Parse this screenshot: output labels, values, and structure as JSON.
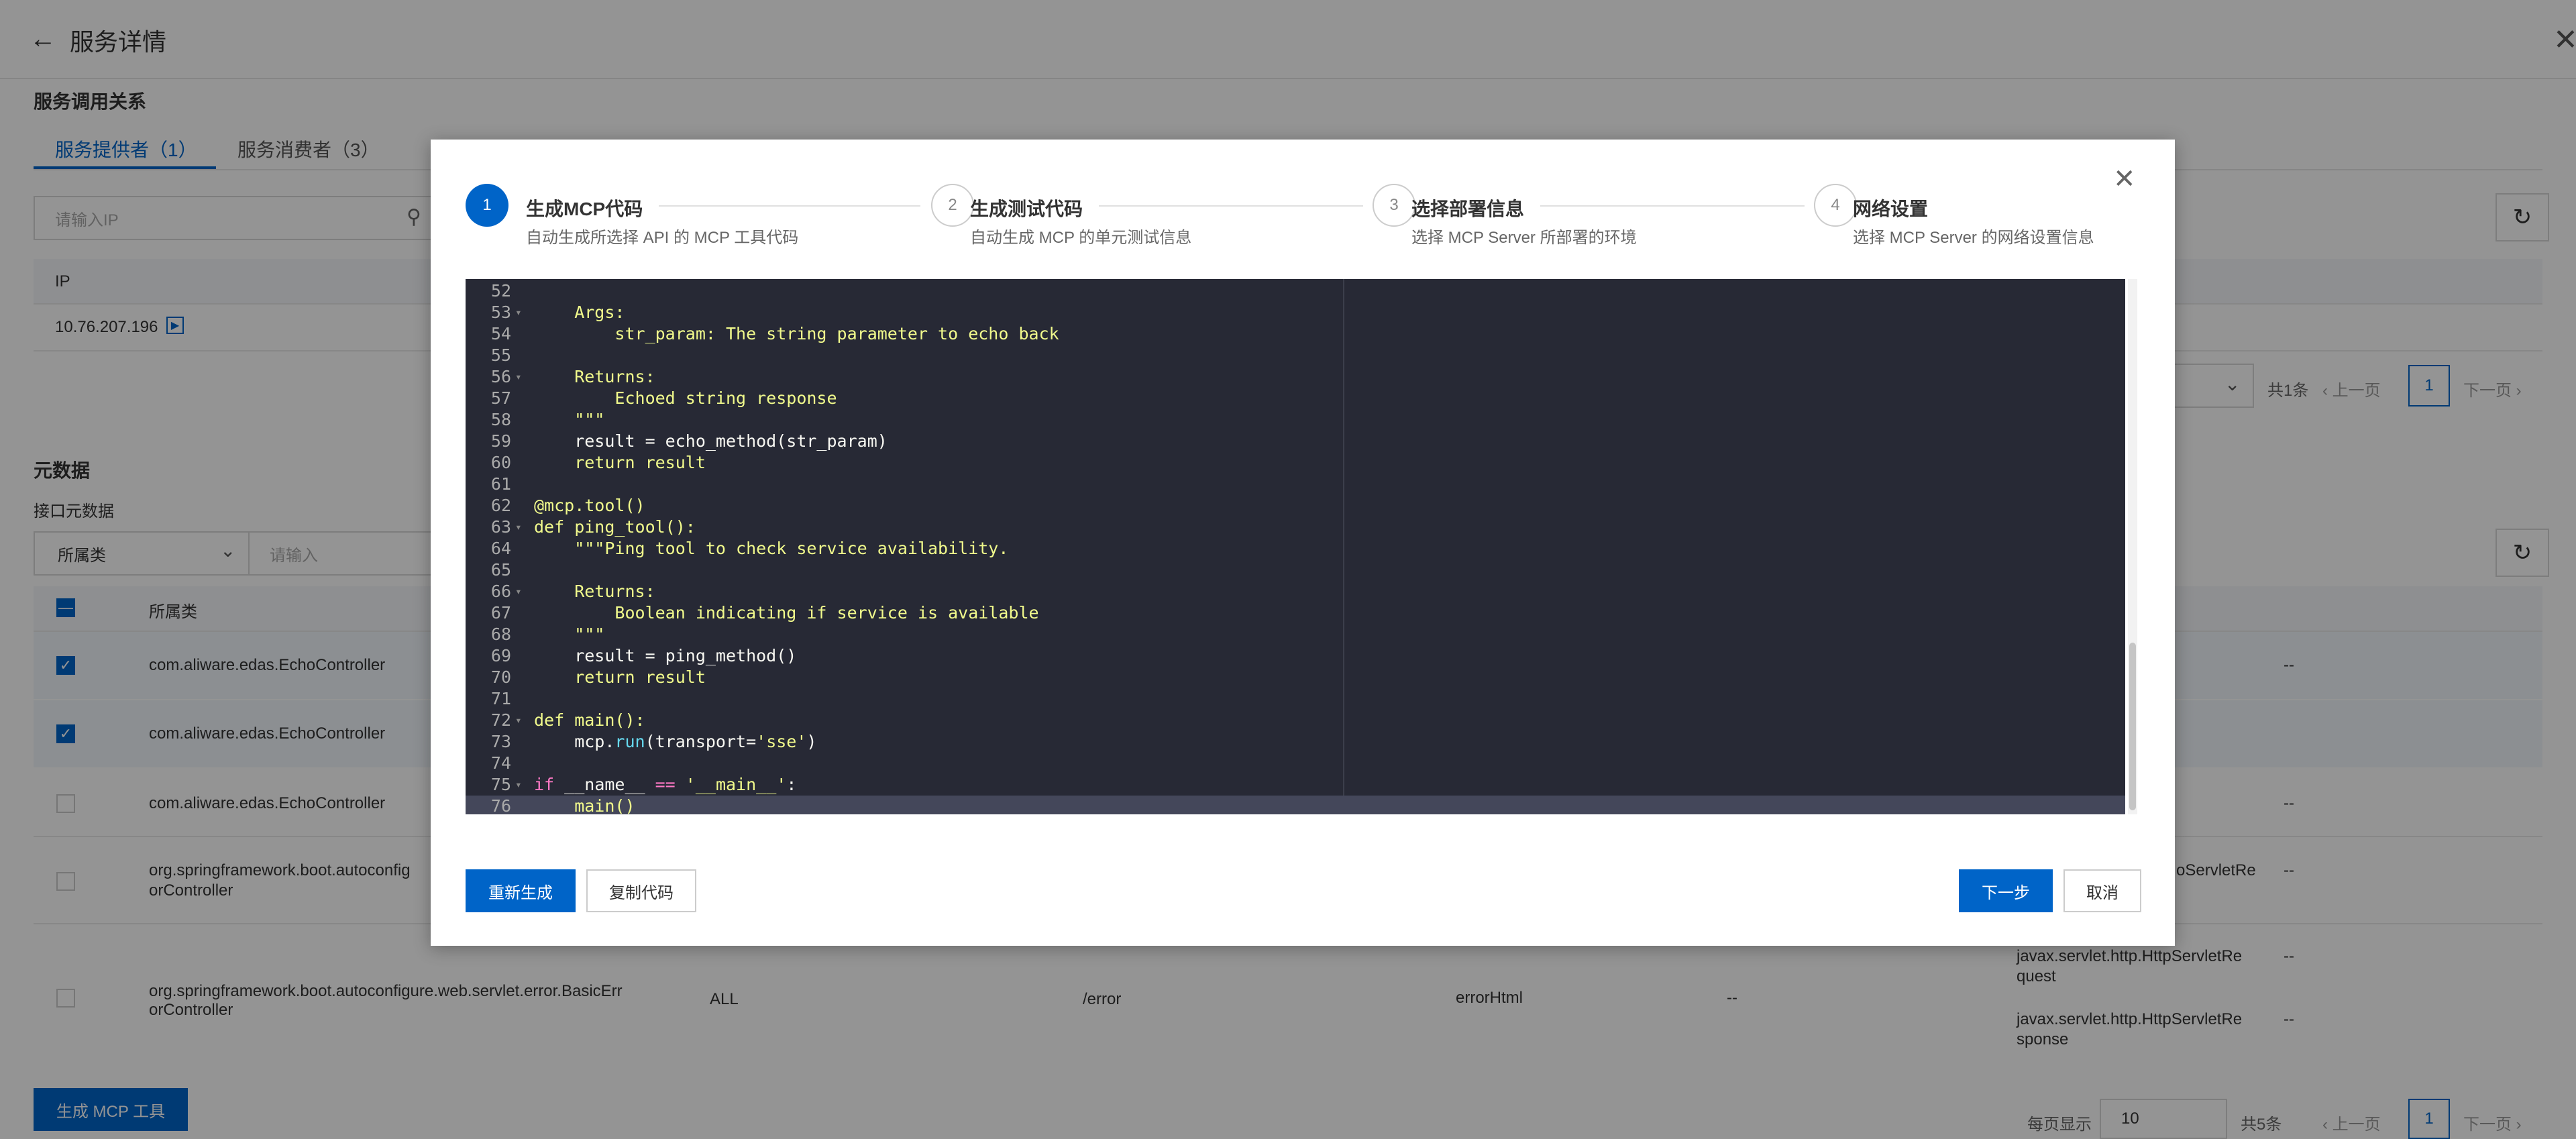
{
  "page": {
    "back_icon": "arrow-left-icon",
    "title": "服务详情",
    "close_icon": "close-icon"
  },
  "relations": {
    "section_title": "服务调用关系",
    "tabs": [
      {
        "label": "服务提供者（1）",
        "active": true
      },
      {
        "label": "服务消费者（3）",
        "active": false
      }
    ],
    "ip_search_placeholder": "请输入IP",
    "table_header_ip": "IP",
    "ip_value": "10.76.207.196",
    "pagination": {
      "total": "共1条",
      "prev": "上一页",
      "current": "1",
      "next": "下一页"
    }
  },
  "metadata": {
    "section_title": "元数据",
    "sub_title": "接口元数据",
    "filter_select": "所属类",
    "filter_placeholder": "请输入",
    "table_header_class": "所属类",
    "rows": [
      {
        "class": "com.aliware.edas.EchoController",
        "checked": true,
        "extra": "--"
      },
      {
        "class": "com.aliware.edas.EchoController",
        "checked": true,
        "extra": ""
      },
      {
        "class": "com.aliware.edas.EchoController",
        "checked": false,
        "extra": "--"
      },
      {
        "class": "org.springframework.boot.autoconfig",
        "class2": "orController",
        "checked": false,
        "param": "oServletRe",
        "extra": "--"
      },
      {
        "class": "org.springframework.boot.autoconfigure.web.servlet.error.BasicErr",
        "class2": "orController",
        "checked": false,
        "method": "ALL",
        "path": "/error",
        "name": "errorHtml",
        "dash": "--",
        "param1a": "javax.servlet.http.HttpServletRe",
        "param1b": "quest",
        "param2a": "javax.servlet.http.HttpServletRe",
        "param2b": "sponse",
        "extra1": "--",
        "extra2": "--"
      }
    ],
    "generate_button": "生成 MCP 工具",
    "pagination": {
      "page_size_label": "每页显示",
      "page_size": "10",
      "total": "共5条",
      "prev": "上一页",
      "current": "1",
      "next": "下一页"
    }
  },
  "modal": {
    "steps": [
      {
        "num": "1",
        "title": "生成MCP代码",
        "desc": "自动生成所选择 API 的 MCP 工具代码",
        "active": true
      },
      {
        "num": "2",
        "title": "生成测试代码",
        "desc": "自动生成 MCP 的单元测试信息",
        "active": false
      },
      {
        "num": "3",
        "title": "选择部署信息",
        "desc": "选择 MCP Server 所部署的环境",
        "active": false
      },
      {
        "num": "4",
        "title": "网络设置",
        "desc": "选择 MCP Server 的网络设置信息",
        "active": false
      }
    ],
    "close_icon": "close-icon",
    "code_lines": [
      {
        "n": "52",
        "fold": false,
        "text": ""
      },
      {
        "n": "53",
        "fold": true,
        "text": "    Args:"
      },
      {
        "n": "54",
        "fold": false,
        "text": "        str_param: The string parameter to echo back"
      },
      {
        "n": "55",
        "fold": false,
        "text": ""
      },
      {
        "n": "56",
        "fold": true,
        "text": "    Returns:"
      },
      {
        "n": "57",
        "fold": false,
        "text": "        Echoed string response"
      },
      {
        "n": "58",
        "fold": false,
        "text": "    \"\"\""
      },
      {
        "n": "59",
        "fold": false,
        "text": "    result = echo_method(str_param)"
      },
      {
        "n": "60",
        "fold": false,
        "text": "    return result"
      },
      {
        "n": "61",
        "fold": false,
        "text": ""
      },
      {
        "n": "62",
        "fold": false,
        "text": "@mcp.tool()"
      },
      {
        "n": "63",
        "fold": true,
        "text": "def ping_tool():"
      },
      {
        "n": "64",
        "fold": false,
        "text": "    \"\"\"Ping tool to check service availability."
      },
      {
        "n": "65",
        "fold": false,
        "text": ""
      },
      {
        "n": "66",
        "fold": true,
        "text": "    Returns:"
      },
      {
        "n": "67",
        "fold": false,
        "text": "        Boolean indicating if service is available"
      },
      {
        "n": "68",
        "fold": false,
        "text": "    \"\"\""
      },
      {
        "n": "69",
        "fold": false,
        "text": "    result = ping_method()"
      },
      {
        "n": "70",
        "fold": false,
        "text": "    return result"
      },
      {
        "n": "71",
        "fold": false,
        "text": ""
      },
      {
        "n": "72",
        "fold": true,
        "text": "def main():"
      },
      {
        "n": "73",
        "fold": false,
        "text": "    mcp.run(transport='sse')"
      },
      {
        "n": "74",
        "fold": false,
        "text": ""
      },
      {
        "n": "75",
        "fold": true,
        "text": "if __name__ == '__main__':"
      },
      {
        "n": "76",
        "fold": false,
        "text": "    main()"
      }
    ],
    "regenerate_button": "重新生成",
    "copy_button": "复制代码",
    "next_button": "下一步",
    "cancel_button": "取消"
  }
}
